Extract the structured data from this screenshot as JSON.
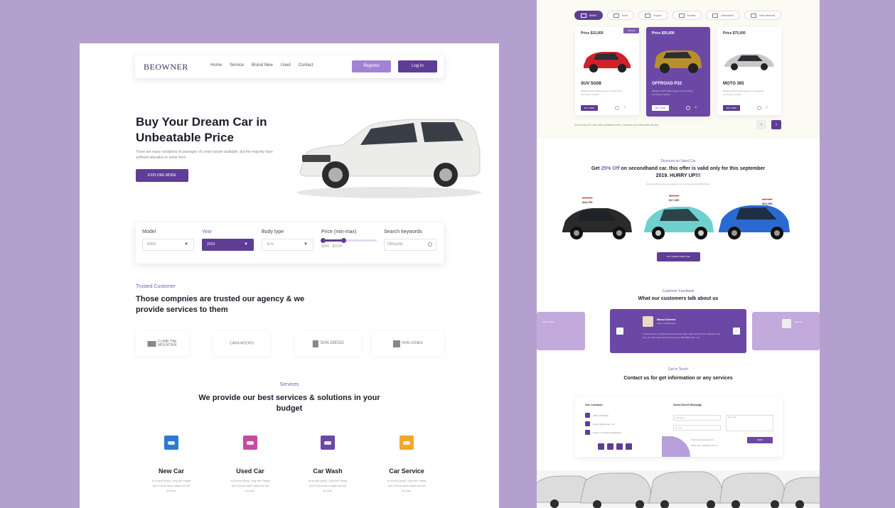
{
  "colors": {
    "background": "#b3a0cf",
    "primary": "#5e3d95",
    "primary_light": "#a482d3",
    "accent_text": "#7a5bb0"
  },
  "left": {
    "nav": {
      "brand": "BEOWNER",
      "links": [
        "Home",
        "Service",
        "Brand New",
        "Used",
        "Contact"
      ],
      "register": "Register",
      "login": "Log In"
    },
    "hero": {
      "title": "Buy Your Dream Car in Unbeatable Price",
      "subtitle": "There are many variations of passages of Lorem Ipsum available, but the majority have suffered alteration in some form.",
      "cta": "EXPLORE MORE"
    },
    "search": {
      "model_label": "Model",
      "model_value": "BMW",
      "year_label": "Year",
      "year_value": "2019",
      "body_label": "Body type",
      "body_value": "SUV",
      "price_label": "Price (min-max)",
      "price_range": "$250 - $1500",
      "price_fill": 0.4,
      "keyword_label": "Search keywords",
      "keyword_value": "Mitsubis",
      "caret": "▼"
    },
    "trusted": {
      "tag": "Trusted Customer",
      "title": "Those compnies are trusted our agency & we provide services to them",
      "logos": [
        "CLIMB THE MOUNTAIN",
        "CARA MOORS",
        "SAN DIEGO",
        "RON JONES"
      ]
    },
    "services": {
      "tag": "Services",
      "title": "We provide our best services & solutions in your budget",
      "items": [
        {
          "title": "New Car",
          "text": "In recent years, only the Fiesta and Focus have made the list of cues.",
          "color": "#2a7bd1",
          "icon": "new-car-icon"
        },
        {
          "title": "Used Car",
          "text": "In recent years, only the Fiesta and Focus have made the list of cues.",
          "color": "#c64aa0",
          "icon": "used-car-icon"
        },
        {
          "title": "Car Wash",
          "text": "In recent years, only the Fiesta and Focus have made the list of cues.",
          "color": "#6b48a6",
          "icon": "car-wash-icon"
        },
        {
          "title": "Car Service",
          "text": "In recent years, only the Fiesta and Focus have made the list of cues.",
          "color": "#f0a82a",
          "icon": "car-service-icon"
        }
      ]
    }
  },
  "right": {
    "tabs": [
      "BMW",
      "Audi",
      "Toyota",
      "Honda",
      "Mitsubishi",
      "New Brands"
    ],
    "cards": [
      {
        "price": "Price $15,000",
        "name": "SUV 5G08",
        "desc": "Mileage 34,521 Miles Engine 4 Horsepower 4x4 Interior Leather",
        "button": "BUY NOW",
        "car_color": "#d0202a"
      },
      {
        "price": "Price $20,000",
        "name": "OFFROAD P32",
        "desc": "Mileage 34,521 Miles Engine 4 Horsepower 4x4 Interior Leather",
        "button": "BUY NOW",
        "car_color": "#b8902a",
        "badge": "Special"
      },
      {
        "price": "Price $75,000",
        "name": "MOTO 365",
        "desc": "Mileage 34,521 Miles Engine 4 Horsepower 4x4 Interior Leather",
        "button": "BUY NOW",
        "car_color": "#c8c8c8"
      }
    ],
    "cards_footer": "More than 50 cars are available here. Choose your favourite Brand.",
    "arrow_prev": "‹",
    "arrow_next": "›",
    "heart": "♡",
    "share": "<",
    "discount": {
      "tag": "Discount on Used Car",
      "title_pre": "Get ",
      "title_hl": "25% Off",
      "title_post": " on secondhand car. this offer is valid only for this september 2019. HURRY UP!!!",
      "sub": "All secondhand cars are available from our factory car 1980 till now",
      "cars": [
        {
          "old": "$25,000",
          "new": "$18,750",
          "color": "#2a2a2a"
        },
        {
          "old": "$23,000",
          "new": "$17,250",
          "color": "#6fd0d0"
        },
        {
          "old": "$27,000",
          "new": "$20,250",
          "color": "#2a6ad0"
        }
      ],
      "button": "BUY MORE USED CAR"
    },
    "feedback": {
      "tag": "Customer Feedback",
      "title": "What our customers talk about us",
      "name": "Manuf Ahmed",
      "role": "Owner of Mercedes",
      "text": "In recent years, only the Fiesta and Focus have made the list of the cheapest new cars. No automotive service being more affordable than ours.",
      "side_left_name": "Jason Hand",
      "side_right_name": "Sam Ali"
    },
    "contact": {
      "tag": "Get in Touch",
      "title": "Contact us for get information or any services",
      "contacts_title": "Our contacts",
      "contacts": [
        "+880 1700 0000",
        "support@beowner.com",
        "Uttara 12, Dhaka, Bangladesh"
      ],
      "form_title": "Send Direct Message",
      "name_ph": "Full Name",
      "email_ph": "E-mail",
      "message_ph": "Message",
      "note1": "Thanks for keep with us",
      "note2": "share your feedback with us",
      "send": "SEND"
    }
  }
}
